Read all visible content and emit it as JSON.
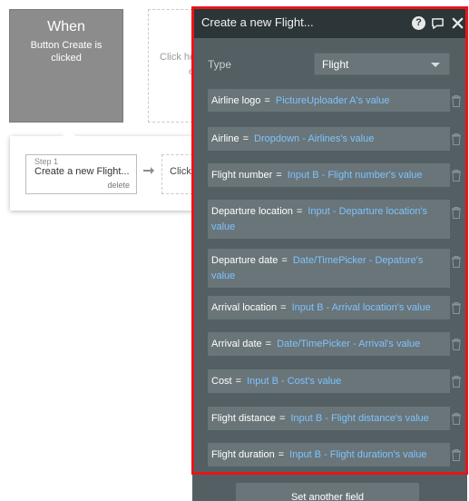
{
  "event": {
    "title": "When",
    "description": "Button Create is clicked"
  },
  "canvas": {
    "click_here_text": "Click he",
    "click_here_text_2": "e"
  },
  "step": {
    "label": "Step 1",
    "title": "Create a new Flight...",
    "delete_label": "delete",
    "next_step_text": "Click"
  },
  "editor": {
    "title": "Create a new Flight...",
    "help_icon": "?",
    "type_label": "Type",
    "type_value": "Flight",
    "fields": [
      {
        "name": "Airline logo",
        "eq": "=",
        "value": "PictureUploader A's value"
      },
      {
        "name": "Airline",
        "eq": "=",
        "value": "Dropdown - Airlines's value"
      },
      {
        "name": "Flight number",
        "eq": "=",
        "value": "Input B - Flight number's value"
      },
      {
        "name": "Departure location",
        "eq": "=",
        "value": "Input - Departure location's value"
      },
      {
        "name": "Departure date",
        "eq": "=",
        "value": "Date/TimePicker - Depature's value"
      },
      {
        "name": "Arrival location",
        "eq": "=",
        "value": "Input B - Arrival location's value"
      },
      {
        "name": "Arrival date",
        "eq": "=",
        "value": "Date/TimePicker - Arrival's value"
      },
      {
        "name": "Cost",
        "eq": "=",
        "value": "Input B - Cost's value"
      },
      {
        "name": "Flight distance",
        "eq": "=",
        "value": "Input B - Flight distance's value"
      },
      {
        "name": "Flight duration",
        "eq": "=",
        "value": "Input B - Flight duration's value"
      }
    ],
    "set_another_field_label": "Set another field"
  },
  "colors": {
    "editor_bg": "#535f63",
    "editor_header": "#2c3538",
    "field_bg": "#6a7579",
    "value_link": "#7cc3ff",
    "highlight": "#e8151b"
  },
  "icons": [
    "help-icon",
    "comment-icon",
    "close-icon",
    "trash-icon",
    "arrow-right-icon",
    "chevron-down-icon"
  ]
}
